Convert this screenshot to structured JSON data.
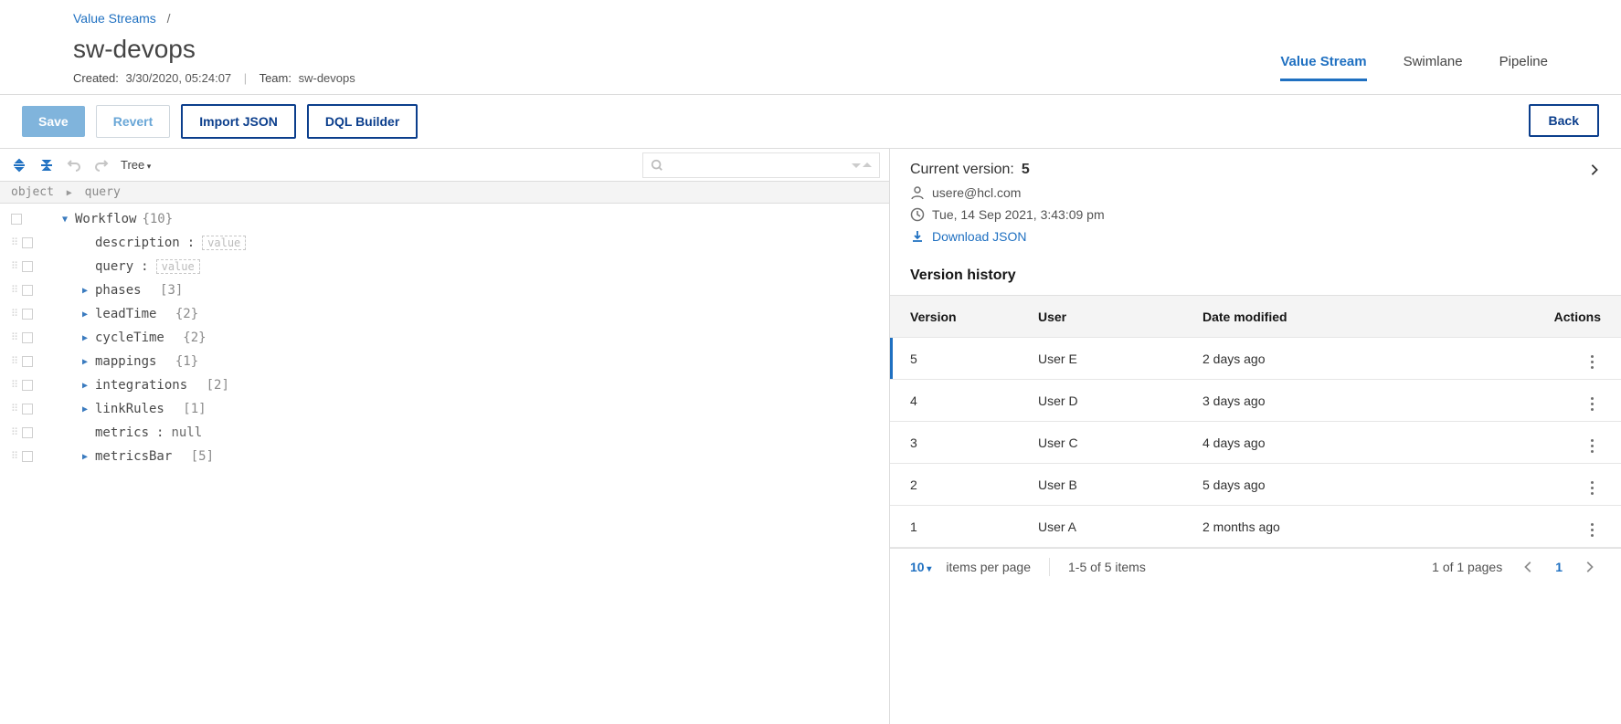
{
  "breadcrumb": {
    "root": "Value Streams",
    "sep": "/"
  },
  "header": {
    "title": "sw-devops",
    "created_label": "Created:",
    "created_value": "3/30/2020, 05:24:07",
    "team_label": "Team:",
    "team_value": "sw-devops"
  },
  "tabs": {
    "value_stream": "Value Stream",
    "swimlane": "Swimlane",
    "pipeline": "Pipeline"
  },
  "toolbar": {
    "save": "Save",
    "revert": "Revert",
    "import_json": "Import JSON",
    "dql_builder": "DQL Builder",
    "back": "Back"
  },
  "editor": {
    "view_mode": "Tree",
    "path": {
      "a": "object",
      "b": "query"
    },
    "root": {
      "key": "Workflow",
      "count": "{10}"
    },
    "nodes": {
      "description": {
        "key": "description",
        "placeholder": "value"
      },
      "query": {
        "key": "query",
        "placeholder": "value"
      },
      "phases": {
        "key": "phases",
        "count": "[3]"
      },
      "leadTime": {
        "key": "leadTime",
        "count": "{2}"
      },
      "cycleTime": {
        "key": "cycleTime",
        "count": "{2}"
      },
      "mappings": {
        "key": "mappings",
        "count": "{1}"
      },
      "integrations": {
        "key": "integrations",
        "count": "[2]"
      },
      "linkRules": {
        "key": "linkRules",
        "count": "[1]"
      },
      "metrics": {
        "key": "metrics",
        "value": "null"
      },
      "metricsBar": {
        "key": "metricsBar",
        "count": "[5]"
      }
    }
  },
  "panel": {
    "current_label": "Current version:",
    "current_value": "5",
    "user": "usere@hcl.com",
    "timestamp": "Tue, 14 Sep 2021, 3:43:09 pm",
    "download": "Download JSON",
    "history_title": "Version history",
    "columns": {
      "version": "Version",
      "user": "User",
      "date": "Date modified",
      "actions": "Actions"
    },
    "rows": [
      {
        "version": "5",
        "user": "User E",
        "date": "2 days ago",
        "selected": true
      },
      {
        "version": "4",
        "user": "User D",
        "date": "3 days ago"
      },
      {
        "version": "3",
        "user": "User C",
        "date": "4 days ago"
      },
      {
        "version": "2",
        "user": "User B",
        "date": "5 days ago"
      },
      {
        "version": "1",
        "user": "User A",
        "date": "2 months ago"
      }
    ],
    "pager": {
      "per_page": "10",
      "per_page_label": "items per page",
      "range": "1-5 of 5 items",
      "pages": "1 of 1 pages",
      "current": "1"
    }
  }
}
